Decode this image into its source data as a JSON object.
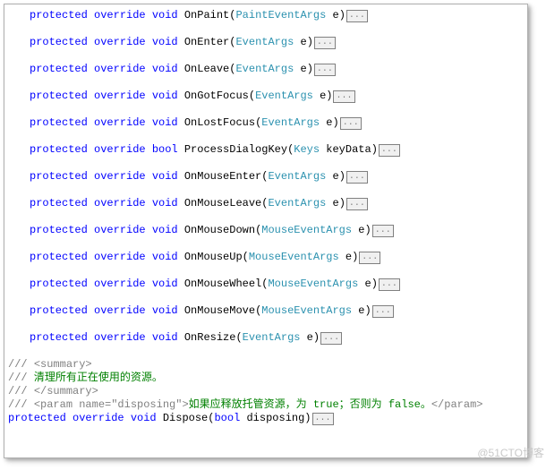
{
  "tokens": {
    "protected": "protected",
    "override": "override",
    "void": "void",
    "bool": "bool",
    "fold": "..."
  },
  "methods": [
    {
      "name": "OnPaint",
      "ret": "void",
      "argType": "PaintEventArgs",
      "argName": "e"
    },
    {
      "name": "OnEnter",
      "ret": "void",
      "argType": "EventArgs",
      "argName": "e"
    },
    {
      "name": "OnLeave",
      "ret": "void",
      "argType": "EventArgs",
      "argName": "e"
    },
    {
      "name": "OnGotFocus",
      "ret": "void",
      "argType": "EventArgs",
      "argName": "e"
    },
    {
      "name": "OnLostFocus",
      "ret": "void",
      "argType": "EventArgs",
      "argName": "e"
    },
    {
      "name": "ProcessDialogKey",
      "ret": "bool",
      "argType": "Keys",
      "argName": "keyData"
    },
    {
      "name": "OnMouseEnter",
      "ret": "void",
      "argType": "EventArgs",
      "argName": "e"
    },
    {
      "name": "OnMouseLeave",
      "ret": "void",
      "argType": "EventArgs",
      "argName": "e"
    },
    {
      "name": "OnMouseDown",
      "ret": "void",
      "argType": "MouseEventArgs",
      "argName": "e"
    },
    {
      "name": "OnMouseUp",
      "ret": "void",
      "argType": "MouseEventArgs",
      "argName": "e"
    },
    {
      "name": "OnMouseWheel",
      "ret": "void",
      "argType": "MouseEventArgs",
      "argName": "e"
    },
    {
      "name": "OnMouseMove",
      "ret": "void",
      "argType": "MouseEventArgs",
      "argName": "e"
    },
    {
      "name": "OnResize",
      "ret": "void",
      "argType": "EventArgs",
      "argName": "e"
    }
  ],
  "comments": {
    "summaryOpen": "<summary>",
    "summaryText": "清理所有正在使用的资源。",
    "summaryClose": "</summary>",
    "paramOpen": "<param name=\"disposing\">",
    "paramText": "如果应释放托管资源，为 true；否则为 false。",
    "paramClose": "</param>",
    "slashes": "///"
  },
  "dispose": {
    "name": "Dispose",
    "ret": "void",
    "argType": "bool",
    "argName": "disposing"
  },
  "watermark": "@51CTO博客"
}
